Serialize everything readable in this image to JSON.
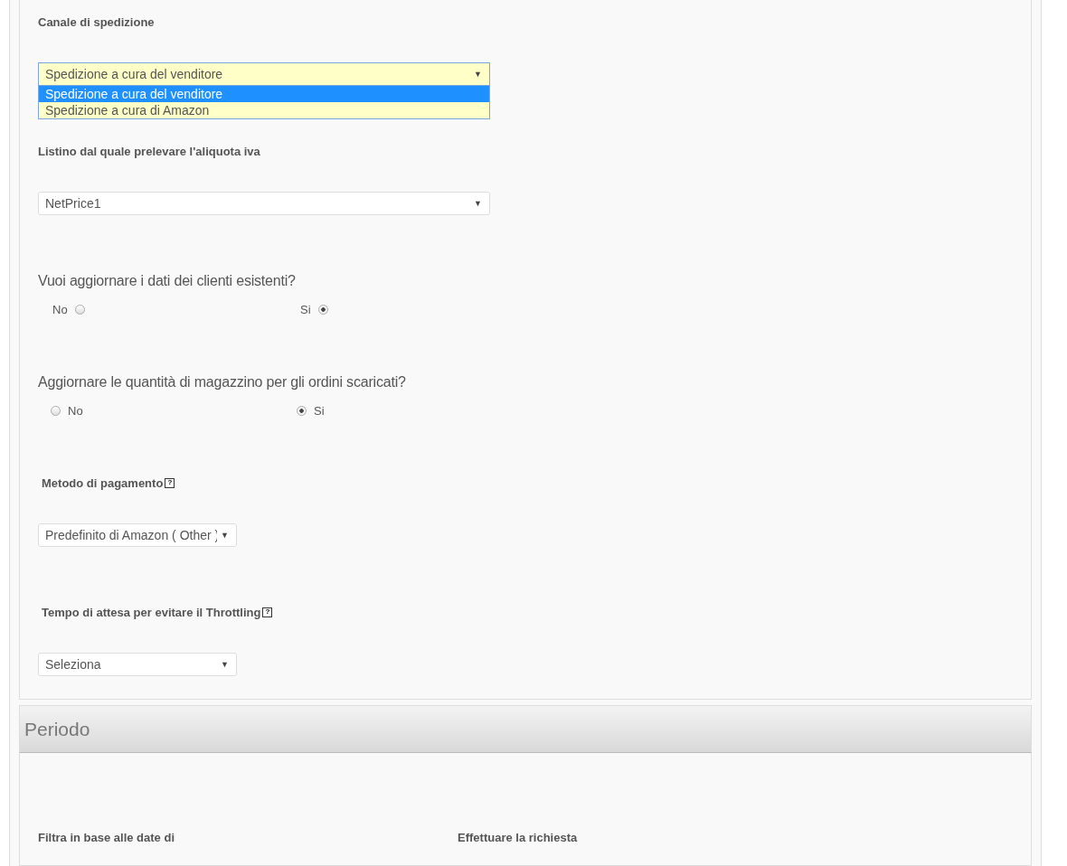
{
  "settings": {
    "fields": [
      {
        "kind": "select",
        "label": "Canale di spedizione",
        "value": "Spedizione a cura del venditore",
        "caret": "▼",
        "open": true,
        "options": [
          {
            "label": "Spedizione a cura del venditore",
            "selected": true
          },
          {
            "label": "Spedizione a cura di Amazon",
            "selected": false
          }
        ]
      },
      {
        "kind": "select",
        "label": "Listino dal quale prelevare l'aliquota iva",
        "value": "NetPrice1",
        "caret": "▼",
        "open": false
      },
      {
        "kind": "radio-label-first",
        "label": "Vuoi aggiornare i dati dei clienti esistenti?",
        "options": [
          {
            "label": "No",
            "selected": false
          },
          {
            "label": "Si",
            "selected": true
          }
        ]
      },
      {
        "kind": "radio-label-last",
        "label": "Aggiornare le quantità di magazzino per gli ordini scaricati?",
        "options": [
          {
            "label": "No",
            "selected": false
          },
          {
            "label": "Si",
            "selected": true
          }
        ]
      },
      {
        "kind": "short-select",
        "label": "Metodo di pagamento",
        "help": "?",
        "value": "Predefinito di Amazon ( Other )",
        "caret": "▼",
        "open": false
      },
      {
        "kind": "short-select",
        "label": "Tempo di attesa per evitare il Throttling",
        "help": "?",
        "value": "Seleziona",
        "caret": "▼",
        "open": false
      }
    ]
  },
  "period": {
    "title": "Periodo",
    "labels": [
      "Filtra in base alle date di",
      "Effettuare la richiesta"
    ]
  }
}
